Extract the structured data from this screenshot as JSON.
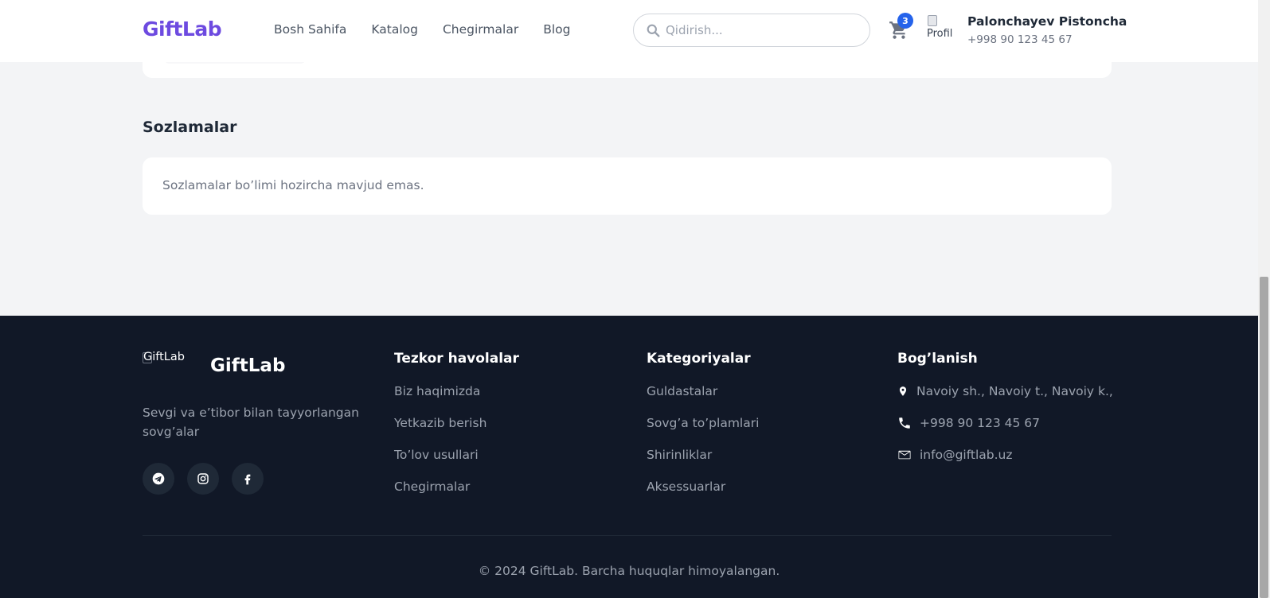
{
  "header": {
    "logo": "GiftLab",
    "nav": [
      "Bosh Sahifa",
      "Katalog",
      "Chegirmalar",
      "Blog"
    ],
    "search_placeholder": "Qidirish...",
    "cart_count": "3",
    "avatar_alt": "Profil",
    "user_name": "Palonchayev Pistoncha",
    "user_phone": "+998 90 123 45 67"
  },
  "main": {
    "settings_title": "Sozlamalar",
    "settings_message": "Sozlamalar bo’limi hozircha mavjud emas."
  },
  "footer": {
    "logo_alt": "GiftLab",
    "brand_name": "GiftLab",
    "tagline": "Sevgi va e’tibor bilan tayyorlangan sovg’alar",
    "socials": [
      "telegram-icon",
      "instagram-icon",
      "facebook-icon"
    ],
    "quick_links": {
      "title": "Tezkor havolalar",
      "items": [
        "Biz haqimizda",
        "Yetkazib berish",
        "To’lov usullari",
        "Chegirmalar"
      ]
    },
    "categories": {
      "title": "Kategoriyalar",
      "items": [
        "Guldastalar",
        "Sovg’a to’plamlari",
        "Shirinliklar",
        "Aksessuarlar"
      ]
    },
    "contact": {
      "title": "Bog’lanish",
      "address": "Navoiy sh., Navoiy t., Navoiy k.,",
      "phone": "+998 90 123 45 67",
      "email": "info@giftlab.uz"
    },
    "copyright": "© 2024 GiftLab. Barcha huquqlar himoyalangan."
  },
  "colors": {
    "brand": "#6d4ae0",
    "footer_bg": "#111827",
    "badge": "#2563eb",
    "page_bg": "#f3f4f6"
  }
}
